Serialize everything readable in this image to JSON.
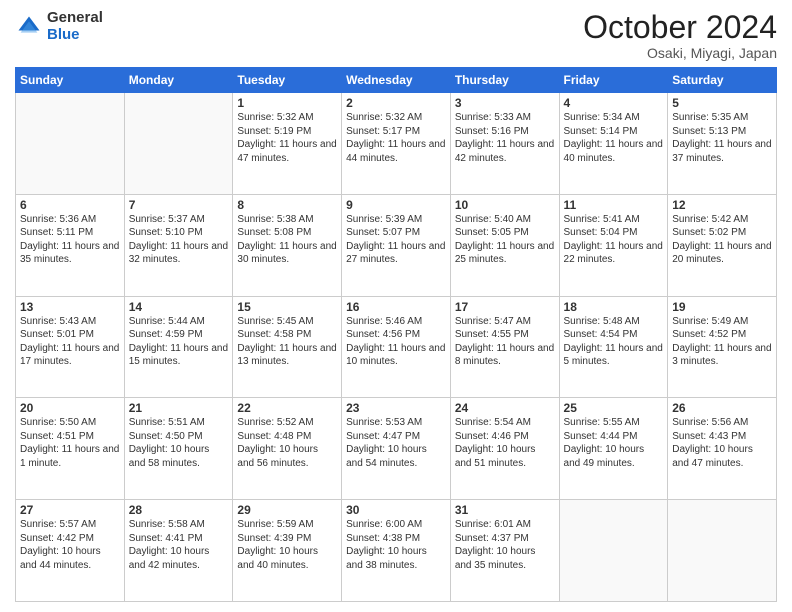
{
  "logo": {
    "general": "General",
    "blue": "Blue"
  },
  "header": {
    "title": "October 2024",
    "subtitle": "Osaki, Miyagi, Japan"
  },
  "weekdays": [
    "Sunday",
    "Monday",
    "Tuesday",
    "Wednesday",
    "Thursday",
    "Friday",
    "Saturday"
  ],
  "weeks": [
    [
      {
        "day": null
      },
      {
        "day": null
      },
      {
        "day": "1",
        "sunrise": "5:32 AM",
        "sunset": "5:19 PM",
        "daylight": "11 hours and 47 minutes."
      },
      {
        "day": "2",
        "sunrise": "5:32 AM",
        "sunset": "5:17 PM",
        "daylight": "11 hours and 44 minutes."
      },
      {
        "day": "3",
        "sunrise": "5:33 AM",
        "sunset": "5:16 PM",
        "daylight": "11 hours and 42 minutes."
      },
      {
        "day": "4",
        "sunrise": "5:34 AM",
        "sunset": "5:14 PM",
        "daylight": "11 hours and 40 minutes."
      },
      {
        "day": "5",
        "sunrise": "5:35 AM",
        "sunset": "5:13 PM",
        "daylight": "11 hours and 37 minutes."
      }
    ],
    [
      {
        "day": "6",
        "sunrise": "5:36 AM",
        "sunset": "5:11 PM",
        "daylight": "11 hours and 35 minutes."
      },
      {
        "day": "7",
        "sunrise": "5:37 AM",
        "sunset": "5:10 PM",
        "daylight": "11 hours and 32 minutes."
      },
      {
        "day": "8",
        "sunrise": "5:38 AM",
        "sunset": "5:08 PM",
        "daylight": "11 hours and 30 minutes."
      },
      {
        "day": "9",
        "sunrise": "5:39 AM",
        "sunset": "5:07 PM",
        "daylight": "11 hours and 27 minutes."
      },
      {
        "day": "10",
        "sunrise": "5:40 AM",
        "sunset": "5:05 PM",
        "daylight": "11 hours and 25 minutes."
      },
      {
        "day": "11",
        "sunrise": "5:41 AM",
        "sunset": "5:04 PM",
        "daylight": "11 hours and 22 minutes."
      },
      {
        "day": "12",
        "sunrise": "5:42 AM",
        "sunset": "5:02 PM",
        "daylight": "11 hours and 20 minutes."
      }
    ],
    [
      {
        "day": "13",
        "sunrise": "5:43 AM",
        "sunset": "5:01 PM",
        "daylight": "11 hours and 17 minutes."
      },
      {
        "day": "14",
        "sunrise": "5:44 AM",
        "sunset": "4:59 PM",
        "daylight": "11 hours and 15 minutes."
      },
      {
        "day": "15",
        "sunrise": "5:45 AM",
        "sunset": "4:58 PM",
        "daylight": "11 hours and 13 minutes."
      },
      {
        "day": "16",
        "sunrise": "5:46 AM",
        "sunset": "4:56 PM",
        "daylight": "11 hours and 10 minutes."
      },
      {
        "day": "17",
        "sunrise": "5:47 AM",
        "sunset": "4:55 PM",
        "daylight": "11 hours and 8 minutes."
      },
      {
        "day": "18",
        "sunrise": "5:48 AM",
        "sunset": "4:54 PM",
        "daylight": "11 hours and 5 minutes."
      },
      {
        "day": "19",
        "sunrise": "5:49 AM",
        "sunset": "4:52 PM",
        "daylight": "11 hours and 3 minutes."
      }
    ],
    [
      {
        "day": "20",
        "sunrise": "5:50 AM",
        "sunset": "4:51 PM",
        "daylight": "11 hours and 1 minute."
      },
      {
        "day": "21",
        "sunrise": "5:51 AM",
        "sunset": "4:50 PM",
        "daylight": "10 hours and 58 minutes."
      },
      {
        "day": "22",
        "sunrise": "5:52 AM",
        "sunset": "4:48 PM",
        "daylight": "10 hours and 56 minutes."
      },
      {
        "day": "23",
        "sunrise": "5:53 AM",
        "sunset": "4:47 PM",
        "daylight": "10 hours and 54 minutes."
      },
      {
        "day": "24",
        "sunrise": "5:54 AM",
        "sunset": "4:46 PM",
        "daylight": "10 hours and 51 minutes."
      },
      {
        "day": "25",
        "sunrise": "5:55 AM",
        "sunset": "4:44 PM",
        "daylight": "10 hours and 49 minutes."
      },
      {
        "day": "26",
        "sunrise": "5:56 AM",
        "sunset": "4:43 PM",
        "daylight": "10 hours and 47 minutes."
      }
    ],
    [
      {
        "day": "27",
        "sunrise": "5:57 AM",
        "sunset": "4:42 PM",
        "daylight": "10 hours and 44 minutes."
      },
      {
        "day": "28",
        "sunrise": "5:58 AM",
        "sunset": "4:41 PM",
        "daylight": "10 hours and 42 minutes."
      },
      {
        "day": "29",
        "sunrise": "5:59 AM",
        "sunset": "4:39 PM",
        "daylight": "10 hours and 40 minutes."
      },
      {
        "day": "30",
        "sunrise": "6:00 AM",
        "sunset": "4:38 PM",
        "daylight": "10 hours and 38 minutes."
      },
      {
        "day": "31",
        "sunrise": "6:01 AM",
        "sunset": "4:37 PM",
        "daylight": "10 hours and 35 minutes."
      },
      {
        "day": null
      },
      {
        "day": null
      }
    ]
  ]
}
